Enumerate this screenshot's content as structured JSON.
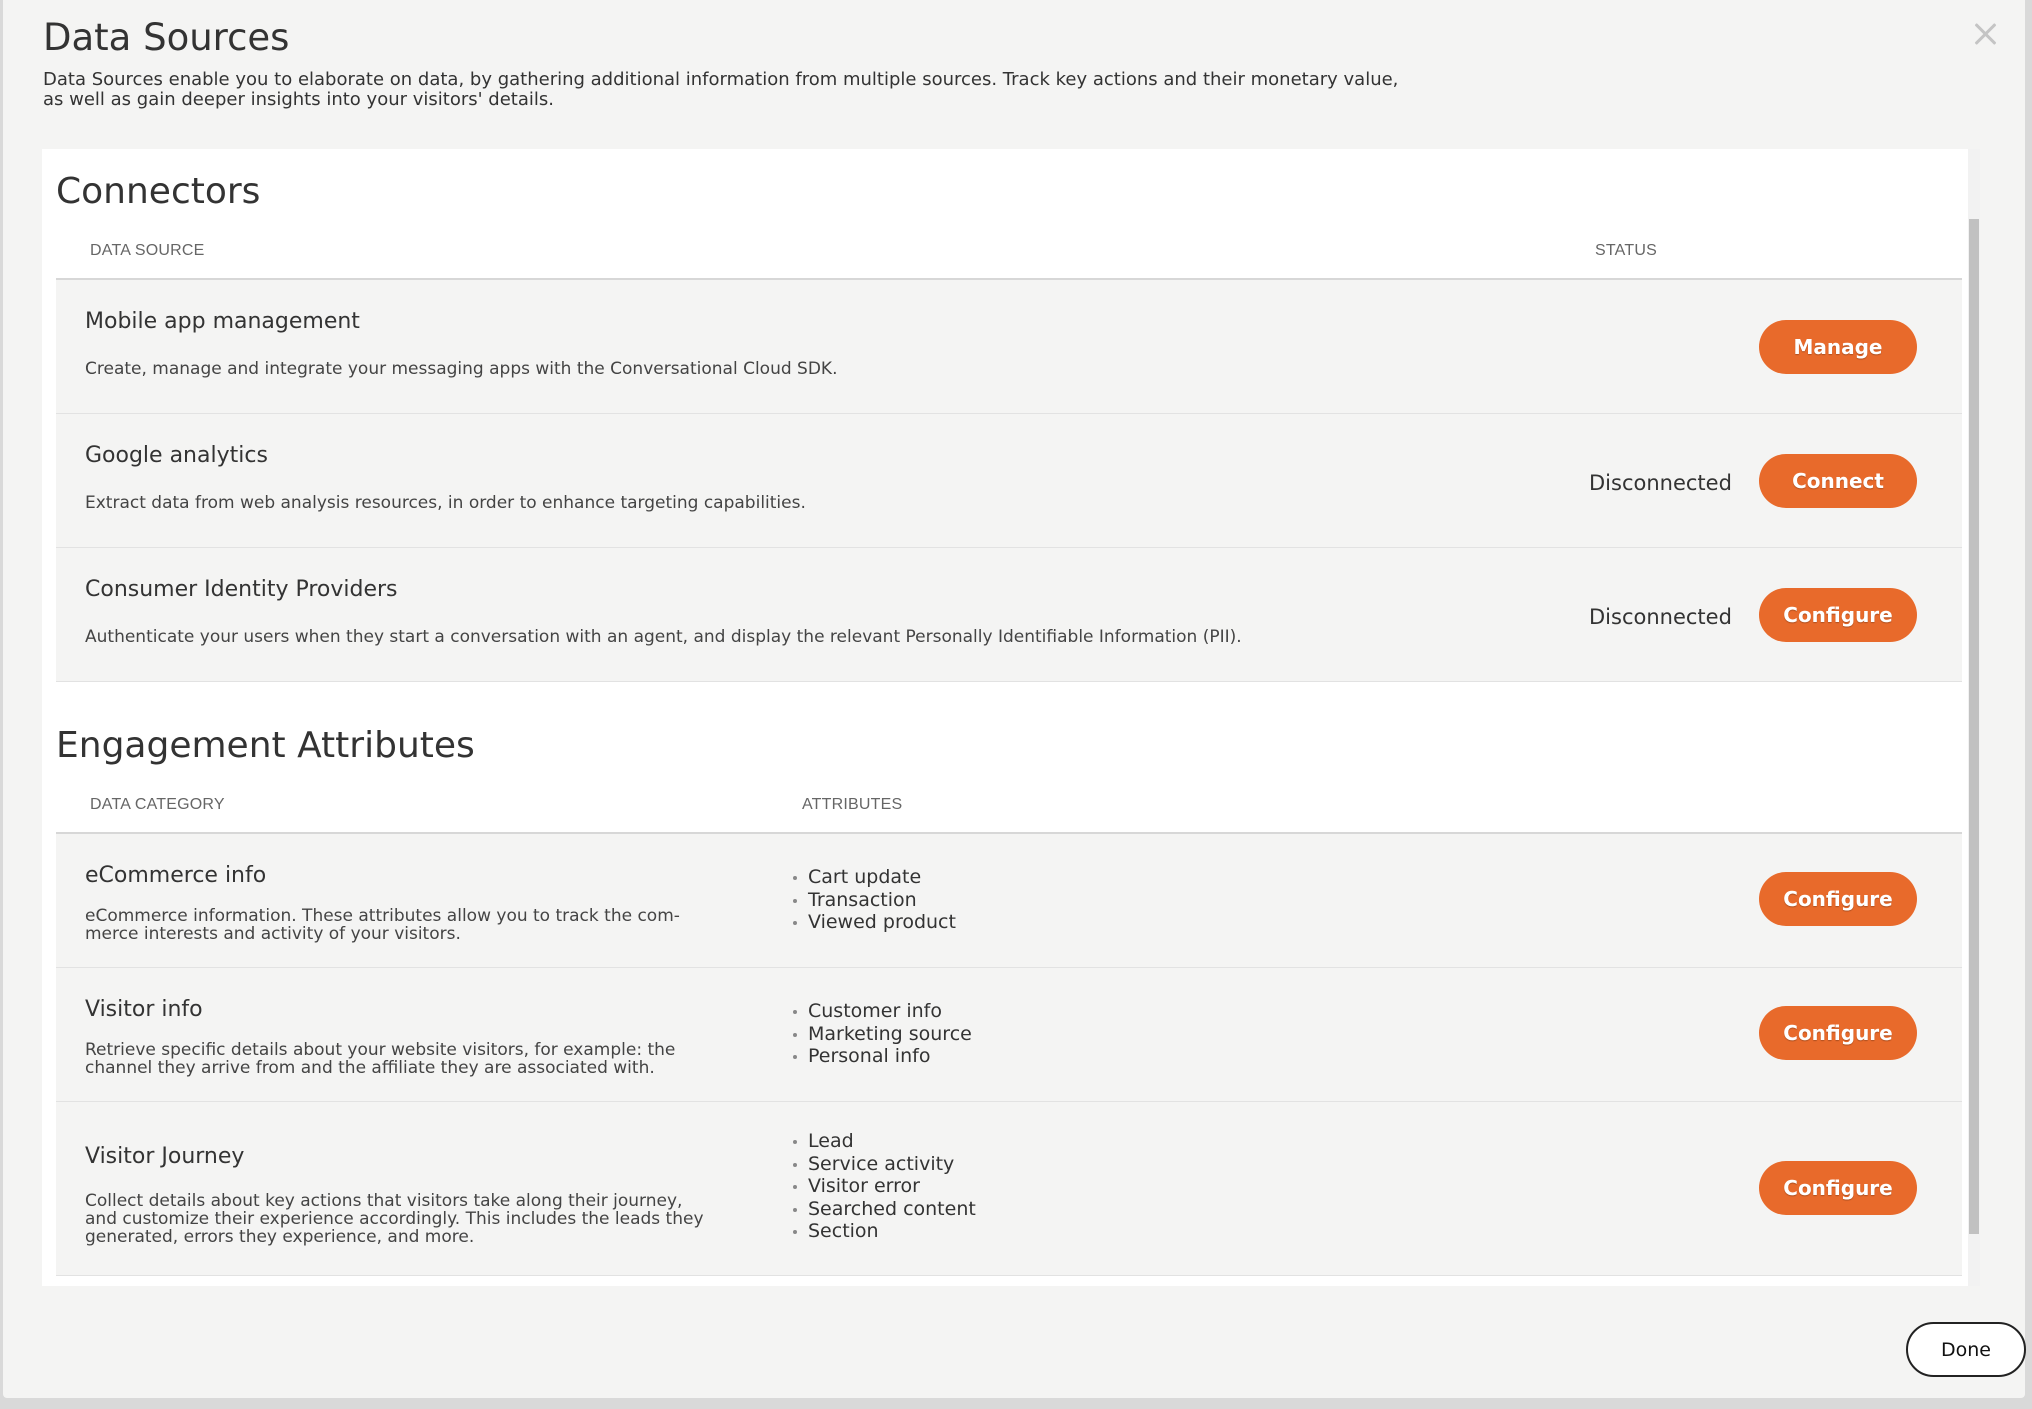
{
  "modal": {
    "title": "Data Sources",
    "description": "Data Sources enable you to elaborate on data, by gathering additional information from multiple sources. Track key actions and their monetary value, as well as gain deeper insights into your visitors' details.",
    "close_icon": "close-icon",
    "done_label": "Done"
  },
  "connectors": {
    "title": "Connectors",
    "col_source": "DATA SOURCE",
    "col_status": "STATUS",
    "rows": [
      {
        "title": "Mobile app management",
        "description": "Create, manage and integrate your messaging apps with the Conversational Cloud SDK.",
        "status": "",
        "action": "Manage"
      },
      {
        "title": "Google analytics",
        "description": "Extract data from web analysis resources, in order to enhance targeting capabilities.",
        "status": "Disconnected",
        "action": "Connect"
      },
      {
        "title": "Consumer Identity Providers",
        "description": "Authenticate your users when they start a conversation with an agent, and display the relevant Personally Identifiable Information (PII).",
        "status": "Disconnected",
        "action": "Configure"
      }
    ]
  },
  "engagement": {
    "title": "Engagement Attributes",
    "col_category": "DATA CATEGORY",
    "col_attributes": "ATTRIBUTES",
    "rows": [
      {
        "title": "eCommerce info",
        "description": "eCommerce information. These attributes allow you to track the com-\nmerce interests and activity of your visitors.",
        "attributes": [
          "Cart update",
          "Transaction",
          "Viewed product"
        ],
        "action": "Configure"
      },
      {
        "title": "Visitor info",
        "description": "Retrieve specific details about your website visitors, for example: the\nchannel they arrive from and the affiliate they are associated with.",
        "attributes": [
          "Customer info",
          "Marketing source",
          "Personal info"
        ],
        "action": "Configure"
      },
      {
        "title": "Visitor Journey",
        "description": "Collect details about key actions that visitors take along their journey,\nand customize their experience accordingly. This includes the leads they\ngenerated, errors they experience, and more.",
        "attributes": [
          "Lead",
          "Service activity",
          "Visitor error",
          "Searched content",
          "Section"
        ],
        "action": "Configure"
      }
    ]
  },
  "colors": {
    "accent": "#e86a2b",
    "row_bg": "#f4f4f3"
  }
}
